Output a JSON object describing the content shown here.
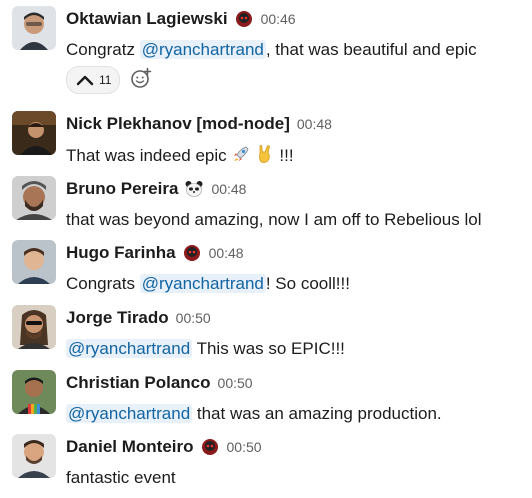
{
  "messages": [
    {
      "name": "Oktawian Lagiewski",
      "badge": "red-skull-badge-icon",
      "time": "00:46",
      "text_before": "Congratz ",
      "mention": "@ryanchartrand",
      "text_after": ", that was beautiful and epic",
      "reaction": {
        "icon": "chevron-up-icon",
        "count": "11"
      }
    },
    {
      "name": "Nick Plekhanov [mod-node]",
      "time": "00:48",
      "text": "That was indeed epic",
      "emojis": [
        "rocket-emoji-icon",
        "rock-on-emoji-icon"
      ],
      "text_tail": "!!!"
    },
    {
      "name": "Bruno Pereira",
      "badge": "panda-badge-icon",
      "time": "00:48",
      "text": "that was beyond amazing, now I am off to Rebelious lol"
    },
    {
      "name": "Hugo Farinha",
      "badge": "red-skull-badge-icon",
      "time": "00:48",
      "text_before": "Congrats ",
      "mention": "@ryanchartrand",
      "text_after": "! So cooll!!!"
    },
    {
      "name": "Jorge Tirado",
      "time": "00:50",
      "mention": "@ryanchartrand",
      "text_after": " This was so EPIC!!!"
    },
    {
      "name": "Christian Polanco",
      "time": "00:50",
      "mention": "@ryanchartrand",
      "text_after": " that was an amazing production."
    },
    {
      "name": "Daniel Monteiro",
      "badge": "red-skull-badge-icon",
      "time": "00:50",
      "text": "fantastic event"
    }
  ],
  "colors": {
    "mention_text": "#1264a3",
    "mention_bg": "#e8f1f9",
    "time": "#616061"
  }
}
